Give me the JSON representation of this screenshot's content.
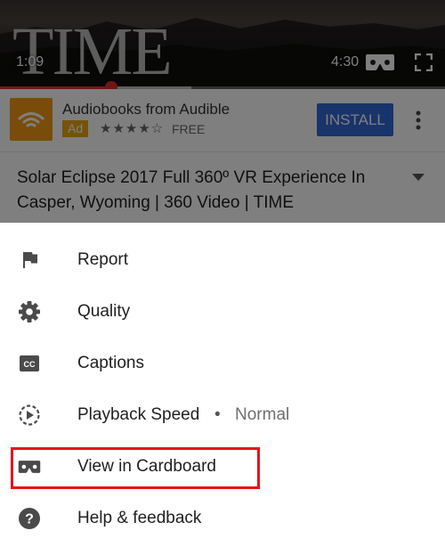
{
  "player": {
    "logo_text": "TIME",
    "elapsed": "1:09",
    "duration": "4:30",
    "progress_fraction": 0.25,
    "buffered_fraction": 0.43,
    "progress_color": "#e52d27",
    "icons": {
      "cardboard": "cardboard-vr-icon",
      "fullscreen": "fullscreen-icon"
    }
  },
  "ad": {
    "title": "Audiobooks from Audible",
    "badge": "Ad",
    "badge_color": "#e8a715",
    "stars": "★★★★☆",
    "price": "FREE",
    "install_label": "INSTALL",
    "install_color": "#3367d6",
    "logo_color": "#f29a12",
    "icons": {
      "logo": "audible-logo-icon",
      "more": "more-vert-icon"
    }
  },
  "video": {
    "title": "Solar Eclipse 2017 Full 360º VR Experience In Casper, Wyoming | 360 Video | TIME",
    "icons": {
      "expand": "chevron-down-icon"
    }
  },
  "menu": {
    "items": [
      {
        "label": "Report",
        "icon": "flag-icon"
      },
      {
        "label": "Quality",
        "icon": "gear-icon"
      },
      {
        "label": "Captions",
        "icon": "closed-captions-icon"
      },
      {
        "label": "Playback Speed",
        "separator": "•",
        "value": "Normal",
        "icon": "playback-speed-icon"
      },
      {
        "label": "View in Cardboard",
        "icon": "cardboard-icon",
        "highlighted": true
      },
      {
        "label": "Help & feedback",
        "icon": "help-icon"
      }
    ],
    "highlight_color": "#e8141b"
  }
}
